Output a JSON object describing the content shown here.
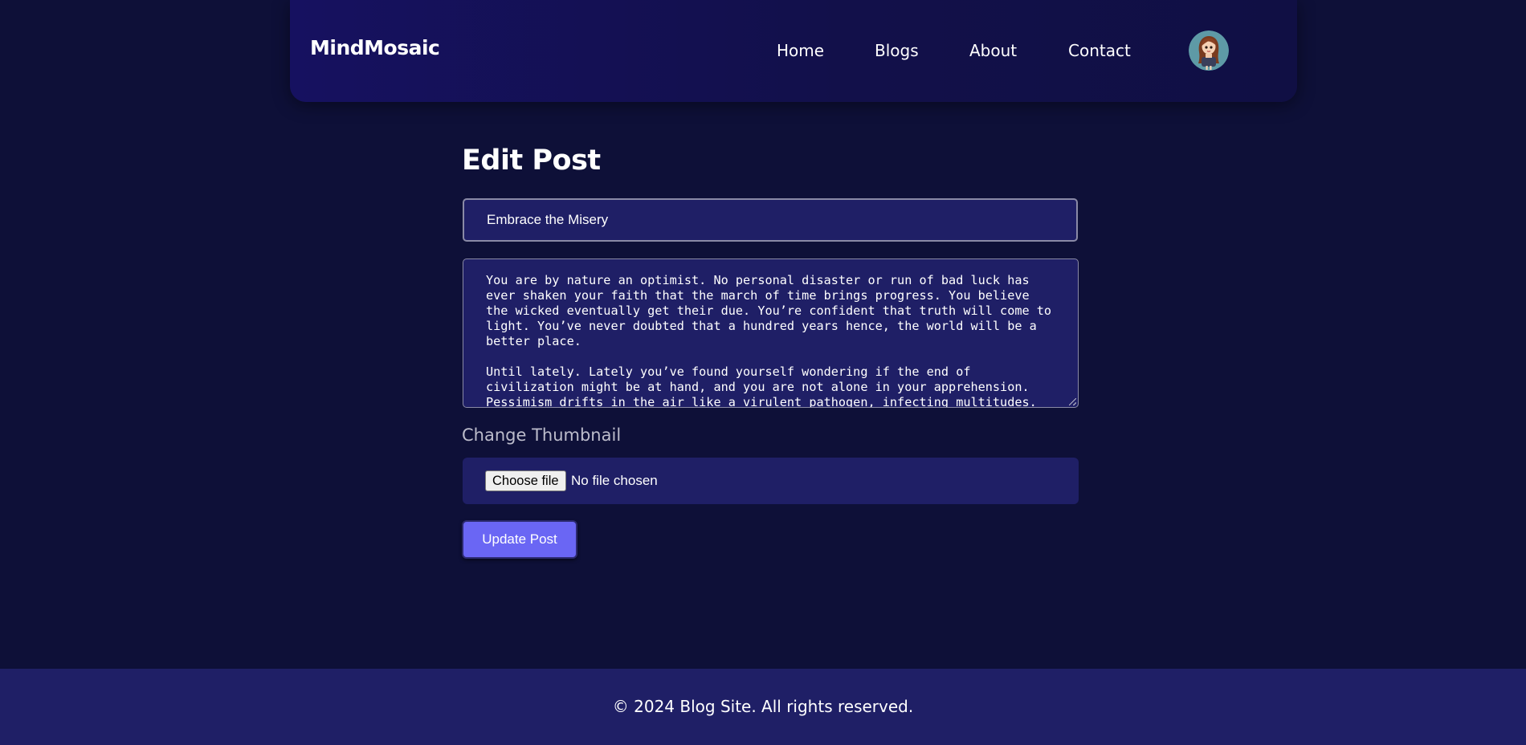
{
  "header": {
    "brand": "MindMosaic",
    "nav": [
      {
        "label": "Home"
      },
      {
        "label": "Blogs"
      },
      {
        "label": "About"
      },
      {
        "label": "Contact"
      }
    ],
    "avatar_icon": "user-avatar-icon"
  },
  "main": {
    "page_title": "Edit Post",
    "title_input_value": "Embrace the Misery",
    "content_paragraphs": [
      "You are by nature an optimist. No personal disaster or run of bad luck has ever shaken your faith that the march of time brings progress. You believe the wicked eventually get their due. You’re confident that truth will come to light. You’ve never doubted that a hundred years hence, the world will be a better place.",
      "Until lately. Lately you’ve found yourself wondering if the end of civilization might be at hand, and you are not alone in your apprehension. Pessimism drifts in the air like a virulent pathogen, infecting multitudes."
    ],
    "thumbnail_label": "Change Thumbnail",
    "file_button_label": "Choose file",
    "file_status": "No file chosen",
    "submit_label": "Update Post"
  },
  "footer": {
    "text": "© 2024 Blog Site. All rights reserved."
  },
  "colors": {
    "page_background": "#0e1038",
    "panel_background": "#1f1f66",
    "accent_button": "#6a66f4",
    "muted_label": "#bcbccb"
  }
}
